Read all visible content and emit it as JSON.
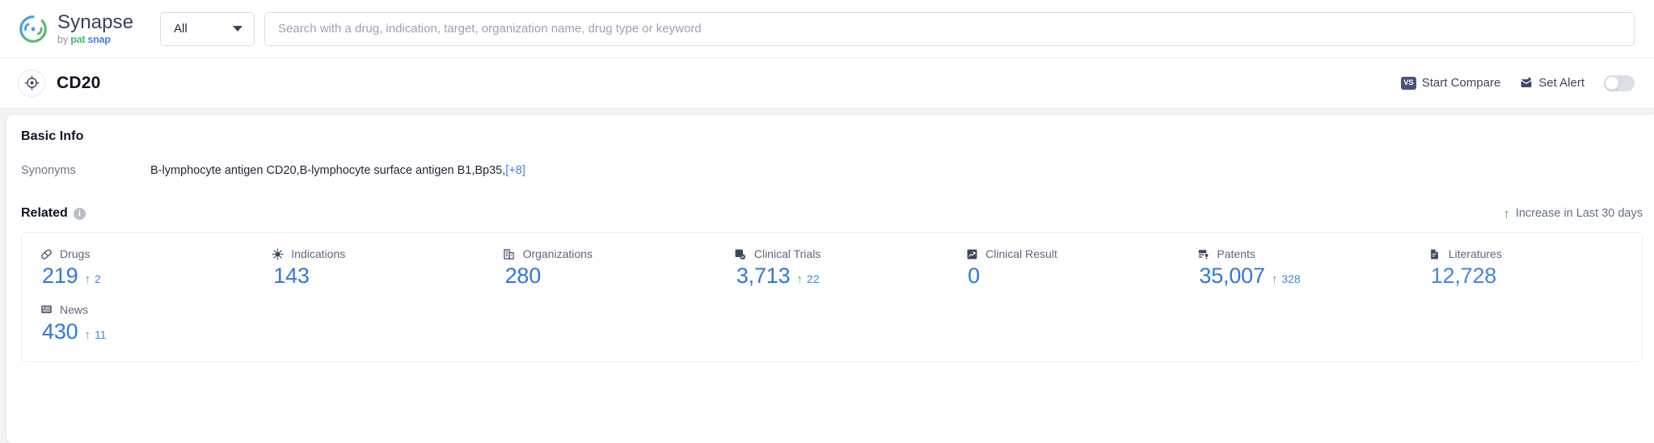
{
  "brand": {
    "name": "Synapse",
    "by": "by",
    "pat": "pat",
    "snap": "snap",
    "logo_icon": "synapse-logo-icon"
  },
  "search": {
    "scope_value": "All",
    "scope_caret_icon": "chevron-down-icon",
    "placeholder": "Search with a drug, indication, target, organization name, drug type or keyword",
    "value": ""
  },
  "entity": {
    "avatar_icon": "target-crosshair-icon",
    "title": "CD20",
    "actions": [
      {
        "label": "Start Compare",
        "icon": "vs-badge-icon",
        "badge_text": "VS"
      },
      {
        "label": "Set Alert",
        "icon": "alert-envelope-icon"
      }
    ],
    "alert_toggle_on": false
  },
  "basic_info": {
    "title": "Basic Info",
    "synonyms_label": "Synonyms",
    "synonyms_value": "B-lymphocyte antigen CD20,B-lymphocyte surface antigen B1,Bp35,",
    "synonyms_more": "[+8]"
  },
  "related": {
    "title": "Related",
    "info_icon": "info-icon",
    "info_glyph": "i",
    "legend_arrow_icon": "arrow-up-icon",
    "legend_text": "Increase in Last 30 days",
    "metrics": [
      {
        "name": "Drugs",
        "icon": "pill-icon",
        "value": "219",
        "delta": "2",
        "has_delta": true
      },
      {
        "name": "Indications",
        "icon": "virus-icon",
        "value": "143",
        "delta": "",
        "has_delta": false
      },
      {
        "name": "Organizations",
        "icon": "building-icon",
        "value": "280",
        "delta": "",
        "has_delta": false
      },
      {
        "name": "Clinical Trials",
        "icon": "clinical-trial-icon",
        "value": "3,713",
        "delta": "22",
        "has_delta": true
      },
      {
        "name": "Clinical Result",
        "icon": "clinical-result-icon",
        "value": "0",
        "delta": "",
        "has_delta": false
      },
      {
        "name": "Patents",
        "icon": "patent-icon",
        "value": "35,007",
        "delta": "328",
        "has_delta": true
      },
      {
        "name": "Literatures",
        "icon": "document-icon",
        "value": "12,728",
        "delta": "",
        "has_delta": false
      },
      {
        "name": "News",
        "icon": "newspaper-icon",
        "value": "430",
        "delta": "11",
        "has_delta": true
      }
    ]
  },
  "colors": {
    "accent_blue": "#3176e0",
    "increase_green": "#4caf50",
    "link_blue": "#3d7ff2",
    "muted_text": "#6d7687"
  }
}
